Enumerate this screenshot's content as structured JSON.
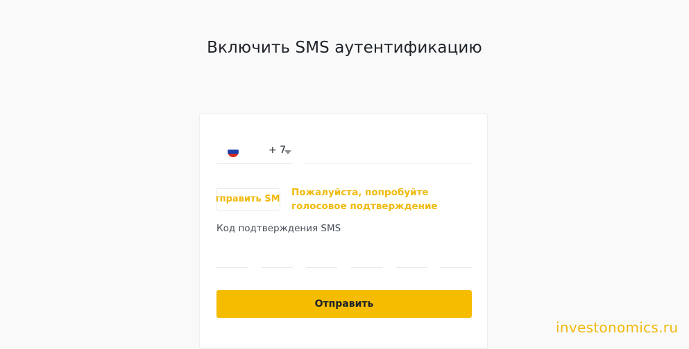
{
  "page": {
    "title": "Включить SMS аутентификацию"
  },
  "phone": {
    "country_flag": "russia-flag-icon",
    "flag_colors": [
      "#ffffff",
      "#1c3fa8",
      "#d52b1e"
    ],
    "dial_code": "+ 7",
    "caret_icon": "chevron-down-icon",
    "number_value": "",
    "number_placeholder": ""
  },
  "sms": {
    "send_label": "Отправить SMS",
    "voice_hint": "Пожалуйста, попробуйте голосовое подтверждение",
    "code_label": "Код подтверждения SMS",
    "code_digits": [
      "",
      "",
      "",
      "",
      "",
      ""
    ]
  },
  "actions": {
    "submit_label": "Отправить"
  },
  "watermark": {
    "text": "investonomics.ru"
  },
  "colors": {
    "accent": "#f0b90b",
    "button": "#f5bc00",
    "background": "#f9f9f9"
  }
}
